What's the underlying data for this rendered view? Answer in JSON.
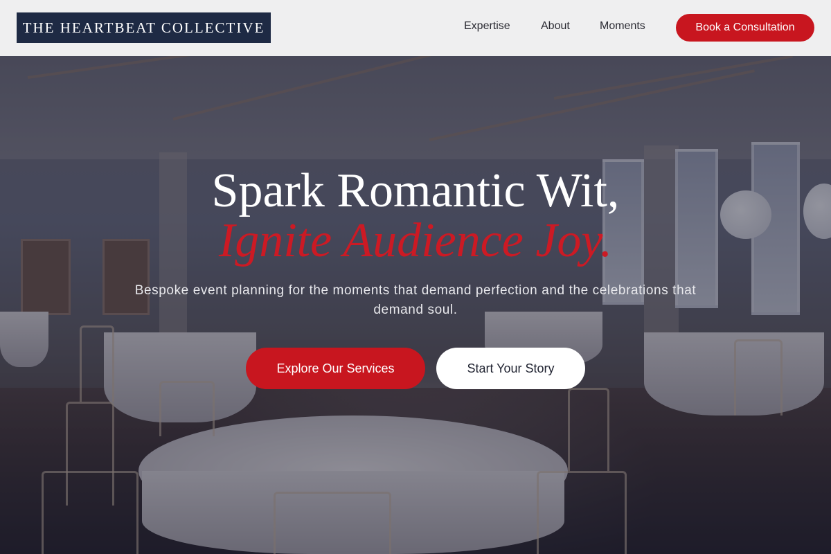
{
  "header": {
    "logo_text": "THE HEARTBEAT COLLECTIVE",
    "nav": [
      {
        "label": "Expertise"
      },
      {
        "label": "About"
      },
      {
        "label": "Moments"
      }
    ],
    "cta_label": "Book a Consultation"
  },
  "hero": {
    "title_line1": "Spark Romantic Wit,",
    "title_line2": "Ignite Audience Joy.",
    "subtitle": "Bespoke event planning for the moments that demand perfection and the celebrations that demand soul.",
    "primary_button": "Explore Our Services",
    "secondary_button": "Start Your Story",
    "background_image": "banquet-hall-photo"
  },
  "colors": {
    "brand_navy": "#1e2a44",
    "accent_red": "#c8161f",
    "header_bg": "#efeff0"
  }
}
